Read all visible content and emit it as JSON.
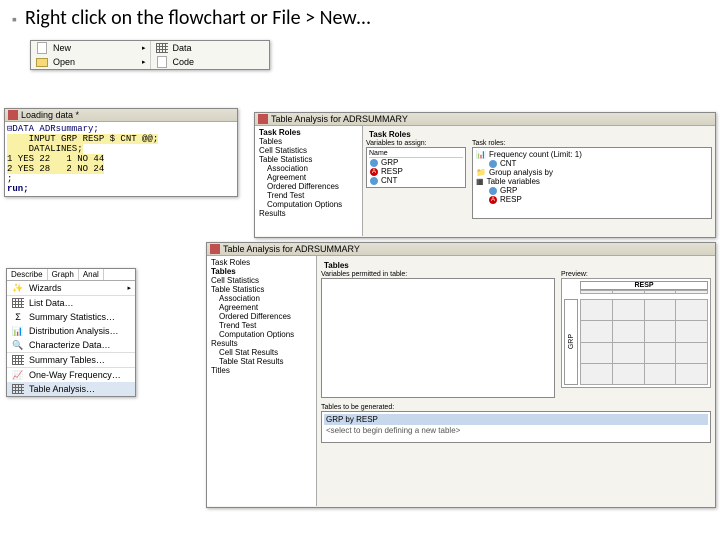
{
  "slide": {
    "bullet_text": "Right click on the flowchart or File > New…"
  },
  "file_menu": {
    "left": [
      {
        "icon": "new-icon",
        "label": "New"
      },
      {
        "icon": "open-icon",
        "label": "Open"
      }
    ],
    "right": [
      {
        "icon": "data-icon",
        "label": "Data"
      },
      {
        "icon": "code-icon",
        "label": "Code"
      }
    ]
  },
  "code_window": {
    "title": "Loading data *",
    "code_lines": [
      "DATA ADRsummary;",
      "    INPUT GRP RESP $ CNT @@;",
      "    DATALINES;",
      "1 YES 22   1 NO 44",
      "2 YES 28   2 NO 24",
      ";",
      "run;"
    ]
  },
  "describe_menu": {
    "tabs": [
      "Describe",
      "Graph",
      "Anal"
    ],
    "items": [
      "Wizards",
      "List Data…",
      "Summary Statistics…",
      "Distribution Analysis…",
      "Characterize Data…",
      "Summary Tables…",
      "One-Way Frequency…",
      "Table Analysis…"
    ]
  },
  "table_analysis_1": {
    "title": "Table Analysis for ADRSUMMARY",
    "nav_heading": "Task Roles",
    "nav_items": [
      "Tables",
      "Cell Statistics",
      "Table Statistics",
      "Association",
      "Agreement",
      "Ordered Differences",
      "Trend Test",
      "Computation Options",
      "Results"
    ],
    "roles_heading": "Task Roles",
    "vars_label": "Variables to assign:",
    "vars_name_col": "Name",
    "vars": [
      "GRP",
      "RESP",
      "CNT"
    ],
    "taskroles_label": "Task roles:",
    "roles": [
      {
        "icon": "freq-icon",
        "label": "Frequency count (Limit: 1)"
      },
      {
        "icon": "var-icon",
        "label": "CNT",
        "indent": true
      },
      {
        "icon": "group-icon",
        "label": "Group analysis by"
      },
      {
        "icon": "table-icon",
        "label": "Table variables"
      },
      {
        "icon": "var-icon",
        "label": "GRP",
        "indent": true
      },
      {
        "icon": "var-icon",
        "label": "RESP",
        "indent": true
      }
    ]
  },
  "table_analysis_2": {
    "title": "Table Analysis for ADRSUMMARY",
    "nav_items": [
      "Task Roles",
      "Tables",
      "Cell Statistics",
      "Table Statistics",
      "Association",
      "Agreement",
      "Ordered Differences",
      "Trend Test",
      "Computation Options",
      "Results",
      "Cell Stat Results",
      "Table Stat Results",
      "Titles"
    ],
    "section_label": "Tables",
    "permitted_label": "Variables permitted in table:",
    "preview_label": "Preview:",
    "preview_col": "RESP",
    "preview_row": "GRP",
    "generated_label": "Tables to be generated:",
    "generated_value": "GRP by RESP",
    "select_hint": "<select to begin defining a new table>"
  }
}
